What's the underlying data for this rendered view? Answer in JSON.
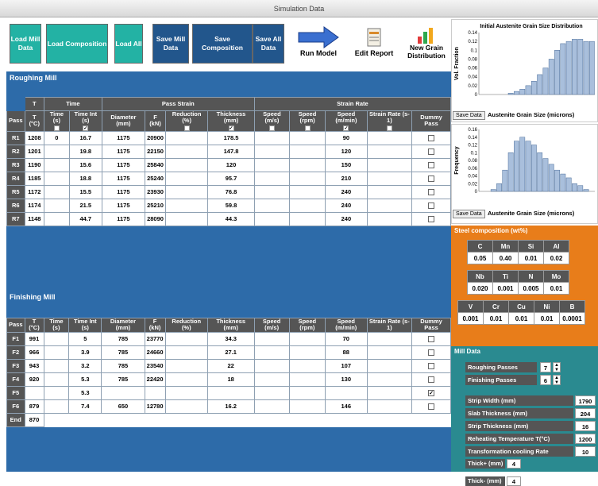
{
  "window": {
    "title": "Simulation Data"
  },
  "toolbar": {
    "load_mill": "Load Mill Data",
    "load_composition": "Load Composition",
    "load_all": "Load All",
    "save_mill": "Save Mill Data",
    "save_composition": "Save Composition",
    "save_all": "Save All Data",
    "run_model": "Run Model",
    "edit_report": "Edit Report",
    "new_grain": "New Grain Distribution"
  },
  "roughing": {
    "title": "Roughing Mill",
    "group_headers": {
      "t": "T",
      "time": "Time",
      "pass_strain": "Pass Strain",
      "strain_rate": "Strain Rate"
    },
    "columns": [
      "Pass",
      "T (°C)",
      "Time (s)",
      "Time Int (s)",
      "Diameter (mm)",
      "F (kN)",
      "Reduction (%)",
      "Thickness (mm)",
      "Speed (m/s)",
      "Speed (rpm)",
      "Speed (m/min)",
      "Strain Rate (s-1)",
      "Dummy Pass"
    ],
    "rows": [
      {
        "pass": "R1",
        "t": "1208",
        "time": "0",
        "time_int": "16.7",
        "diameter": "1175",
        "f": "20900",
        "reduction": "",
        "thickness": "178.5",
        "speed_ms": "",
        "speed_rpm": "",
        "speed_mmin": "90",
        "strain_rate": ""
      },
      {
        "pass": "R2",
        "t": "1201",
        "time": "",
        "time_int": "19.8",
        "diameter": "1175",
        "f": "22150",
        "reduction": "",
        "thickness": "147.8",
        "speed_ms": "",
        "speed_rpm": "",
        "speed_mmin": "120",
        "strain_rate": ""
      },
      {
        "pass": "R3",
        "t": "1190",
        "time": "",
        "time_int": "15.6",
        "diameter": "1175",
        "f": "25840",
        "reduction": "",
        "thickness": "120",
        "speed_ms": "",
        "speed_rpm": "",
        "speed_mmin": "150",
        "strain_rate": ""
      },
      {
        "pass": "R4",
        "t": "1185",
        "time": "",
        "time_int": "18.8",
        "diameter": "1175",
        "f": "25240",
        "reduction": "",
        "thickness": "95.7",
        "speed_ms": "",
        "speed_rpm": "",
        "speed_mmin": "210",
        "strain_rate": ""
      },
      {
        "pass": "R5",
        "t": "1172",
        "time": "",
        "time_int": "15.5",
        "diameter": "1175",
        "f": "23930",
        "reduction": "",
        "thickness": "76.8",
        "speed_ms": "",
        "speed_rpm": "",
        "speed_mmin": "240",
        "strain_rate": ""
      },
      {
        "pass": "R6",
        "t": "1174",
        "time": "",
        "time_int": "21.5",
        "diameter": "1175",
        "f": "25210",
        "reduction": "",
        "thickness": "59.8",
        "speed_ms": "",
        "speed_rpm": "",
        "speed_mmin": "240",
        "strain_rate": ""
      },
      {
        "pass": "R7",
        "t": "1148",
        "time": "",
        "time_int": "44.7",
        "diameter": "1175",
        "f": "28090",
        "reduction": "",
        "thickness": "44.3",
        "speed_ms": "",
        "speed_rpm": "",
        "speed_mmin": "240",
        "strain_rate": ""
      }
    ]
  },
  "finishing": {
    "title": "Finishing Mill",
    "columns": [
      "Pass",
      "T (°C)",
      "Time (s)",
      "Time Int (s)",
      "Diameter (mm)",
      "F (kN)",
      "Reduction (%)",
      "Thickness (mm)",
      "Speed (m/s)",
      "Speed (rpm)",
      "Speed (m/min)",
      "Strain Rate (s-1)",
      "Dummy Pass"
    ],
    "rows": [
      {
        "pass": "F1",
        "t": "991",
        "time": "",
        "time_int": "5",
        "diameter": "785",
        "f": "23770",
        "reduction": "",
        "thickness": "34.3",
        "speed_ms": "",
        "speed_rpm": "",
        "speed_mmin": "70",
        "strain_rate": "",
        "dummy": ""
      },
      {
        "pass": "F2",
        "t": "966",
        "time": "",
        "time_int": "3.9",
        "diameter": "785",
        "f": "24660",
        "reduction": "",
        "thickness": "27.1",
        "speed_ms": "",
        "speed_rpm": "",
        "speed_mmin": "88",
        "strain_rate": "",
        "dummy": ""
      },
      {
        "pass": "F3",
        "t": "943",
        "time": "",
        "time_int": "3.2",
        "diameter": "785",
        "f": "23540",
        "reduction": "",
        "thickness": "22",
        "speed_ms": "",
        "speed_rpm": "",
        "speed_mmin": "107",
        "strain_rate": "",
        "dummy": ""
      },
      {
        "pass": "F4",
        "t": "920",
        "time": "",
        "time_int": "5.3",
        "diameter": "785",
        "f": "22420",
        "reduction": "",
        "thickness": "18",
        "speed_ms": "",
        "speed_rpm": "",
        "speed_mmin": "130",
        "strain_rate": "",
        "dummy": ""
      },
      {
        "pass": "F5",
        "t": "",
        "time": "",
        "time_int": "5.3",
        "diameter": "",
        "f": "",
        "reduction": "",
        "thickness": "",
        "speed_ms": "",
        "speed_rpm": "",
        "speed_mmin": "",
        "strain_rate": "",
        "dummy": "✓"
      },
      {
        "pass": "F6",
        "t": "879",
        "time": "",
        "time_int": "7.4",
        "diameter": "650",
        "f": "12780",
        "reduction": "",
        "thickness": "16.2",
        "speed_ms": "",
        "speed_rpm": "",
        "speed_mmin": "146",
        "strain_rate": "",
        "dummy": ""
      },
      {
        "pass": "End",
        "t": "870"
      }
    ]
  },
  "chart1": {
    "save": "Save Data",
    "xlabel": "Austenite Grain Size (microns)"
  },
  "chart2": {
    "save": "Save Data",
    "xlabel": "Austenite Grain Size (microns)"
  },
  "chart_data": [
    {
      "type": "bar",
      "title": "Initial Austenite Grain Size Distribution",
      "ylabel": "Vol. Fraction",
      "xlabel": "Austenite Grain Size (microns)",
      "ylim": [
        0,
        0.14
      ],
      "yticks": [
        "0.14",
        "0.12",
        "0.1",
        "0.08",
        "0.06",
        "0.04",
        "0.02",
        "0"
      ],
      "values": [
        0,
        0,
        0,
        0,
        0,
        0.003,
        0.007,
        0.012,
        0.02,
        0.03,
        0.045,
        0.06,
        0.08,
        0.1,
        0.115,
        0.12,
        0.125,
        0.125,
        0.12,
        0.12
      ]
    },
    {
      "type": "bar",
      "title": "",
      "ylabel": "Frequency",
      "xlabel": "Austenite Grain Size (microns)",
      "ylim": [
        0,
        0.16
      ],
      "yticks": [
        "0.16",
        "0.14",
        "0.12",
        "0.1",
        "0.08",
        "0.06",
        "0.04",
        "0.02",
        "0"
      ],
      "values": [
        0,
        0,
        0.005,
        0.02,
        0.055,
        0.1,
        0.13,
        0.14,
        0.13,
        0.12,
        0.1,
        0.085,
        0.07,
        0.055,
        0.045,
        0.035,
        0.02,
        0.015,
        0.005,
        0
      ]
    }
  ],
  "composition": {
    "title": "Steel composition (wt%)",
    "row1_labels": [
      "C",
      "Mn",
      "Si",
      "Al"
    ],
    "row1_values": [
      "0.05",
      "0.40",
      "0.01",
      "0.02"
    ],
    "row2_labels": [
      "Nb",
      "Ti",
      "N",
      "Mo"
    ],
    "row2_values": [
      "0.020",
      "0.001",
      "0.005",
      "0.01"
    ],
    "row3_labels": [
      "V",
      "Cr",
      "Cu",
      "Ni",
      "B"
    ],
    "row3_values": [
      "0.001",
      "0.01",
      "0.01",
      "0.01",
      "0.0001"
    ]
  },
  "mill_data": {
    "title": "Mill Data",
    "roughing_passes_label": "Roughing Passes",
    "roughing_passes": "7",
    "finishing_passes_label": "Finishing Passes",
    "finishing_passes": "6",
    "strip_width_label": "Strip Width (mm)",
    "strip_width": "1790",
    "slab_thickness_label": "Slab Thickness (mm)",
    "slab_thickness": "204",
    "strip_thickness_label": "Strip Thickness (mm)",
    "strip_thickness": "16",
    "reheating_label": "Reheating Temperature T(°C)",
    "reheating": "1200",
    "cooling_label": "Transformation cooling Rate",
    "cooling": "10",
    "thick_plus_label": "Thick+ (mm)",
    "thick_plus": "4",
    "thick_minus_label": "Thick- (mm)",
    "thick_minus": "4"
  }
}
